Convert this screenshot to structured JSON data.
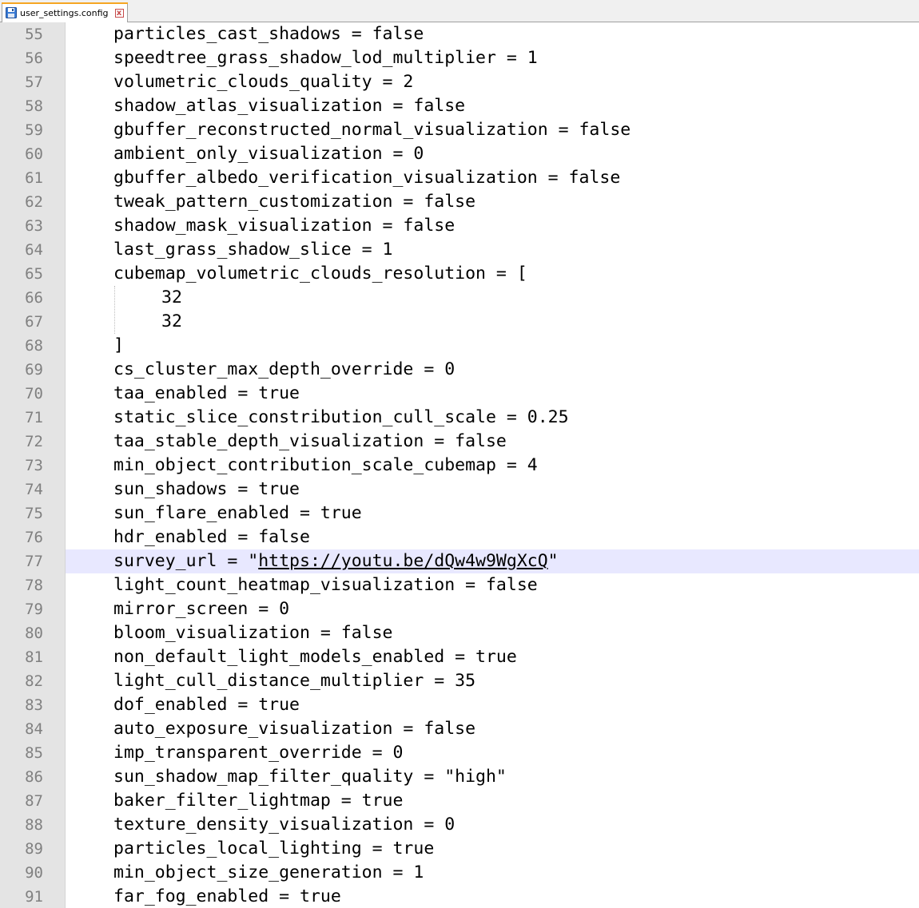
{
  "tab": {
    "filename": "user_settings.config",
    "save_icon": "save-icon",
    "close_icon": "close-icon",
    "close_glyph": "x"
  },
  "colors": {
    "gutter_bg": "#e4e4e4",
    "line_number": "#808080",
    "current_line_bg": "#e8e8ff",
    "text": "#000000",
    "tab_accent": "#f5a623"
  },
  "current_line": 77,
  "lines": [
    {
      "n": "55",
      "text": "particles_cast_shadows = false"
    },
    {
      "n": "56",
      "text": "speedtree_grass_shadow_lod_multiplier = 1"
    },
    {
      "n": "57",
      "text": "volumetric_clouds_quality = 2"
    },
    {
      "n": "58",
      "text": "shadow_atlas_visualization = false"
    },
    {
      "n": "59",
      "text": "gbuffer_reconstructed_normal_visualization = false"
    },
    {
      "n": "60",
      "text": "ambient_only_visualization = 0"
    },
    {
      "n": "61",
      "text": "gbuffer_albedo_verification_visualization = false"
    },
    {
      "n": "62",
      "text": "tweak_pattern_customization = false"
    },
    {
      "n": "63",
      "text": "shadow_mask_visualization = false"
    },
    {
      "n": "64",
      "text": "last_grass_shadow_slice = 1"
    },
    {
      "n": "65",
      "text": "cubemap_volumetric_clouds_resolution = ["
    },
    {
      "n": "66",
      "text": "32",
      "nested": true
    },
    {
      "n": "67",
      "text": "32",
      "nested": true
    },
    {
      "n": "68",
      "text": "]"
    },
    {
      "n": "69",
      "text": "cs_cluster_max_depth_override = 0"
    },
    {
      "n": "70",
      "text": "taa_enabled = true"
    },
    {
      "n": "71",
      "text": "static_slice_constribution_cull_scale = 0.25"
    },
    {
      "n": "72",
      "text": "taa_stable_depth_visualization = false"
    },
    {
      "n": "73",
      "text": "min_object_contribution_scale_cubemap = 4"
    },
    {
      "n": "74",
      "text": "sun_shadows = true"
    },
    {
      "n": "75",
      "text": "sun_flare_enabled = true"
    },
    {
      "n": "76",
      "text": "hdr_enabled = false"
    },
    {
      "n": "77",
      "text": "survey_url = \"",
      "link": "https://youtu.be/dQw4w9WgXcQ",
      "after": "\""
    },
    {
      "n": "78",
      "text": "light_count_heatmap_visualization = false"
    },
    {
      "n": "79",
      "text": "mirror_screen = 0"
    },
    {
      "n": "80",
      "text": "bloom_visualization = false"
    },
    {
      "n": "81",
      "text": "non_default_light_models_enabled = true"
    },
    {
      "n": "82",
      "text": "light_cull_distance_multiplier = 35"
    },
    {
      "n": "83",
      "text": "dof_enabled = true"
    },
    {
      "n": "84",
      "text": "auto_exposure_visualization = false"
    },
    {
      "n": "85",
      "text": "imp_transparent_override = 0"
    },
    {
      "n": "86",
      "text": "sun_shadow_map_filter_quality = \"high\""
    },
    {
      "n": "87",
      "text": "baker_filter_lightmap = true"
    },
    {
      "n": "88",
      "text": "texture_density_visualization = 0"
    },
    {
      "n": "89",
      "text": "particles_local_lighting = true"
    },
    {
      "n": "90",
      "text": "min_object_size_generation = 1"
    },
    {
      "n": "91",
      "text": "far_fog_enabled = true"
    }
  ]
}
